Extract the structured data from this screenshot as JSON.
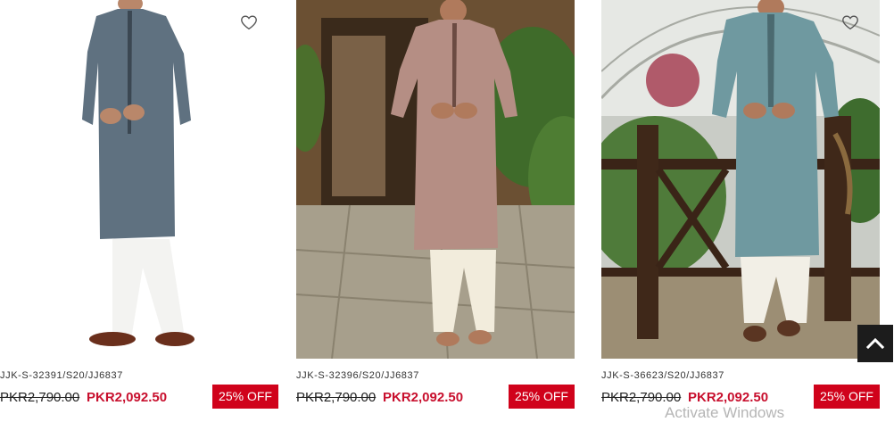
{
  "products": [
    {
      "sku": "JJK-S-32391/S20/JJ6837",
      "old_price": "PKR2,790.00",
      "new_price": "PKR2,092.50",
      "badge": "25% OFF",
      "wishlist_icon": "heart-outline-icon"
    },
    {
      "sku": "JJK-S-32396/S20/JJ6837",
      "old_price": "PKR2,790.00",
      "new_price": "PKR2,092.50",
      "badge": "25% OFF",
      "wishlist_icon": "heart-outline-icon"
    },
    {
      "sku": "JJK-S-36623/S20/JJ6837",
      "old_price": "PKR2,790.00",
      "new_price": "PKR2,092.50",
      "badge": "25% OFF",
      "wishlist_icon": "heart-outline-icon"
    }
  ],
  "back_to_top_icon": "chevron-up-icon",
  "watermark": "Activate Windows",
  "colors": {
    "sale_price": "#c8102e",
    "badge_bg": "#d0021b",
    "back_to_top_bg": "#1c1c1c"
  }
}
